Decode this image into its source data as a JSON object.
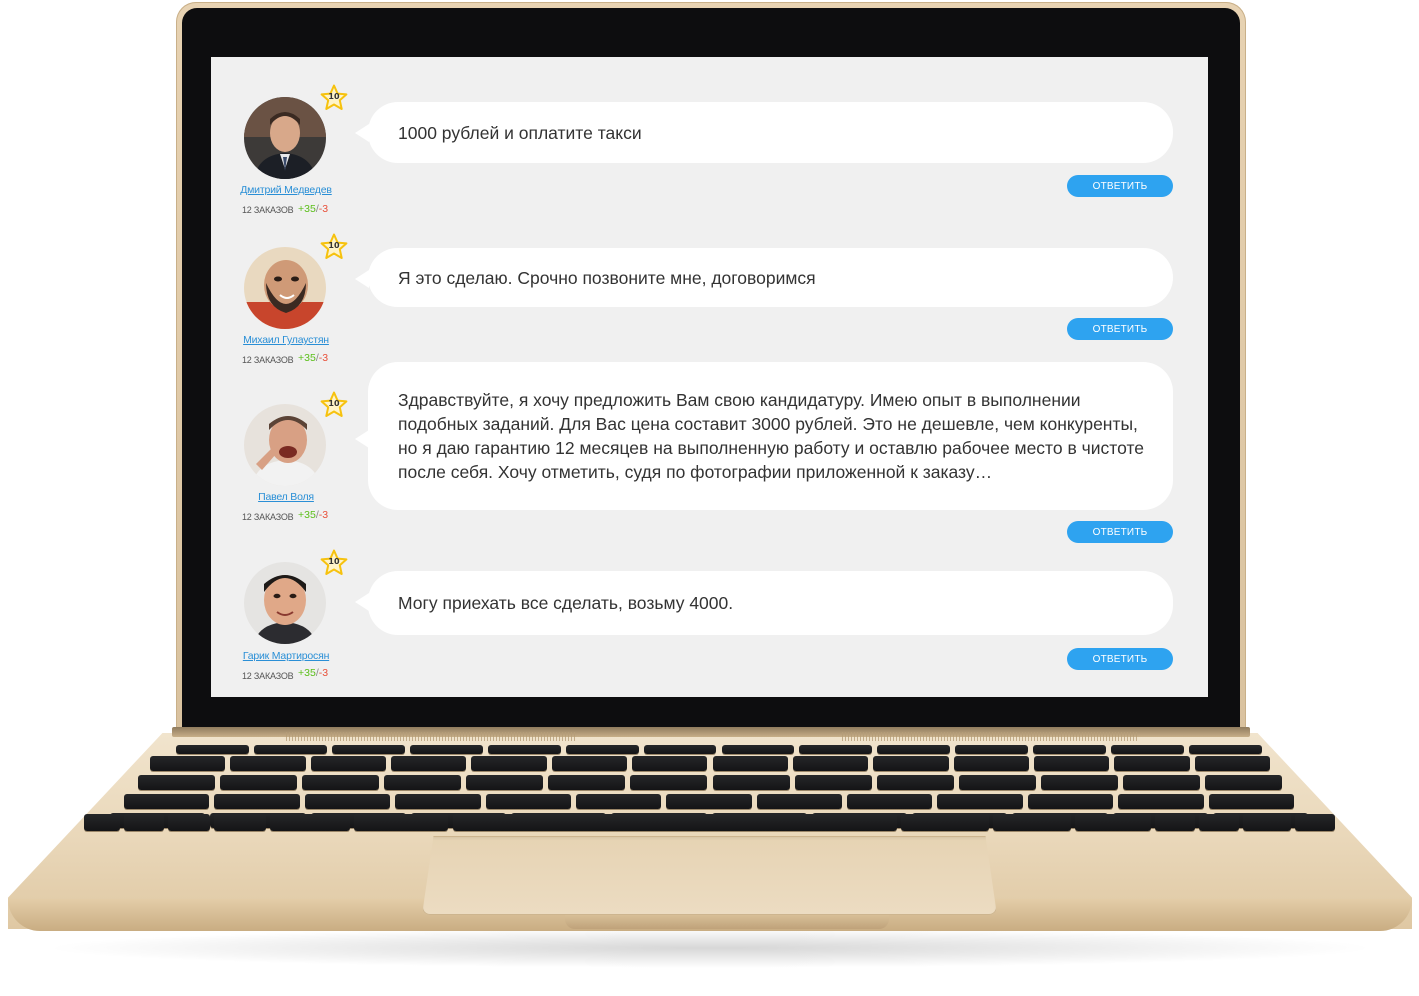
{
  "messages": [
    {
      "author": "Дмитрий Медведев",
      "level": "10",
      "orders": "12 ЗАКАЗОВ",
      "rating_pos": "+35",
      "rating_sep": "/",
      "rating_neg": "-3",
      "text": "1000 рублей и оплатите такси",
      "reply_label": "ОТВЕТИТЬ"
    },
    {
      "author": "Михаил Гулаустян",
      "level": "10",
      "orders": "12 ЗАКАЗОВ",
      "rating_pos": "+35",
      "rating_sep": "/",
      "rating_neg": "-3",
      "text": "Я это сделаю. Срочно позвоните мне, договоримся",
      "reply_label": "ОТВЕТИТЬ"
    },
    {
      "author": "Павел Воля",
      "level": "10",
      "orders": "12 ЗАКАЗОВ",
      "rating_pos": "+35",
      "rating_sep": "/",
      "rating_neg": "-3",
      "text": "Здравствуйте, я хочу предложить Вам свою кандидатуру. Имею опыт в выполнении подобных заданий. Для Вас цена составит 3000 рублей. Это не дешевле, чем конкуренты, но я даю гарантию 12 месяцев на выполненную работу и оставлю рабочее место в чистоте после себя.  Хочу отметить, судя по фотографии приложенной к заказу…",
      "reply_label": "ОТВЕТИТЬ"
    },
    {
      "author": "Гарик Мартиросян",
      "level": "10",
      "orders": "12 ЗАКАЗОВ",
      "rating_pos": "+35",
      "rating_sep": "/",
      "rating_neg": "-3",
      "text": "Могу приехать все сделать, возьму 4000.",
      "reply_label": "ОТВЕТИТЬ"
    }
  ],
  "colors": {
    "accent": "#2ea3f0",
    "link": "#2a8fd6",
    "positive": "#5bbf1a",
    "negative": "#e8503a",
    "screen_bg": "#f0f0f0",
    "star": "#f6c20f"
  },
  "icons": {
    "star": "star-badge-icon",
    "avatar": "user-avatar-icon"
  }
}
